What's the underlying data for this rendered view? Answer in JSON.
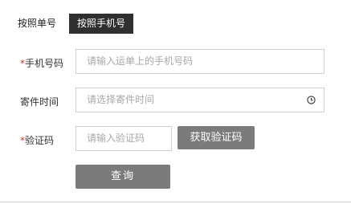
{
  "tabs": {
    "by_order": "按照单号",
    "by_phone": "按照手机号"
  },
  "form": {
    "phone": {
      "required_mark": "*",
      "label": "手机号码",
      "placeholder": "请输入运单上的手机号码"
    },
    "send_time": {
      "label": "寄件时间",
      "placeholder": "请选择寄件时间",
      "icon": "clock-icon"
    },
    "captcha": {
      "required_mark": "*",
      "label": "验证码",
      "placeholder": "请输入验证码"
    }
  },
  "buttons": {
    "get_code": "获取验证码",
    "query": "查询"
  },
  "colors": {
    "required": "#d9322b",
    "active_tab_bg": "#2f2f2f",
    "button_bg": "#7b7b7b"
  }
}
